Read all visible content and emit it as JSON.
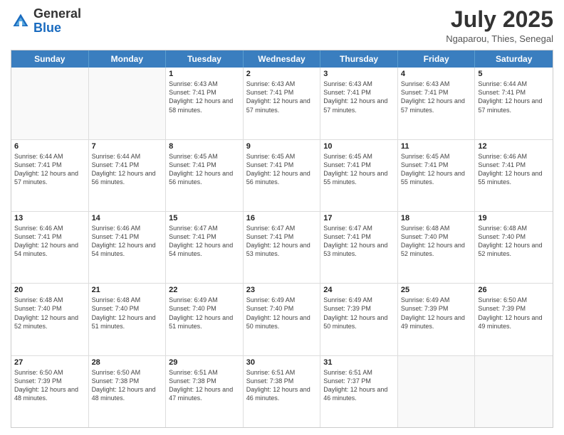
{
  "header": {
    "logo_general": "General",
    "logo_blue": "Blue",
    "month_year": "July 2025",
    "location": "Ngaparou, Thies, Senegal"
  },
  "days_of_week": [
    "Sunday",
    "Monday",
    "Tuesday",
    "Wednesday",
    "Thursday",
    "Friday",
    "Saturday"
  ],
  "weeks": [
    [
      {
        "day": "",
        "sunrise": "",
        "sunset": "",
        "daylight": "",
        "empty": true
      },
      {
        "day": "",
        "sunrise": "",
        "sunset": "",
        "daylight": "",
        "empty": true
      },
      {
        "day": "1",
        "sunrise": "Sunrise: 6:43 AM",
        "sunset": "Sunset: 7:41 PM",
        "daylight": "Daylight: 12 hours and 58 minutes."
      },
      {
        "day": "2",
        "sunrise": "Sunrise: 6:43 AM",
        "sunset": "Sunset: 7:41 PM",
        "daylight": "Daylight: 12 hours and 57 minutes."
      },
      {
        "day": "3",
        "sunrise": "Sunrise: 6:43 AM",
        "sunset": "Sunset: 7:41 PM",
        "daylight": "Daylight: 12 hours and 57 minutes."
      },
      {
        "day": "4",
        "sunrise": "Sunrise: 6:43 AM",
        "sunset": "Sunset: 7:41 PM",
        "daylight": "Daylight: 12 hours and 57 minutes."
      },
      {
        "day": "5",
        "sunrise": "Sunrise: 6:44 AM",
        "sunset": "Sunset: 7:41 PM",
        "daylight": "Daylight: 12 hours and 57 minutes."
      }
    ],
    [
      {
        "day": "6",
        "sunrise": "Sunrise: 6:44 AM",
        "sunset": "Sunset: 7:41 PM",
        "daylight": "Daylight: 12 hours and 57 minutes."
      },
      {
        "day": "7",
        "sunrise": "Sunrise: 6:44 AM",
        "sunset": "Sunset: 7:41 PM",
        "daylight": "Daylight: 12 hours and 56 minutes."
      },
      {
        "day": "8",
        "sunrise": "Sunrise: 6:45 AM",
        "sunset": "Sunset: 7:41 PM",
        "daylight": "Daylight: 12 hours and 56 minutes."
      },
      {
        "day": "9",
        "sunrise": "Sunrise: 6:45 AM",
        "sunset": "Sunset: 7:41 PM",
        "daylight": "Daylight: 12 hours and 56 minutes."
      },
      {
        "day": "10",
        "sunrise": "Sunrise: 6:45 AM",
        "sunset": "Sunset: 7:41 PM",
        "daylight": "Daylight: 12 hours and 55 minutes."
      },
      {
        "day": "11",
        "sunrise": "Sunrise: 6:45 AM",
        "sunset": "Sunset: 7:41 PM",
        "daylight": "Daylight: 12 hours and 55 minutes."
      },
      {
        "day": "12",
        "sunrise": "Sunrise: 6:46 AM",
        "sunset": "Sunset: 7:41 PM",
        "daylight": "Daylight: 12 hours and 55 minutes."
      }
    ],
    [
      {
        "day": "13",
        "sunrise": "Sunrise: 6:46 AM",
        "sunset": "Sunset: 7:41 PM",
        "daylight": "Daylight: 12 hours and 54 minutes."
      },
      {
        "day": "14",
        "sunrise": "Sunrise: 6:46 AM",
        "sunset": "Sunset: 7:41 PM",
        "daylight": "Daylight: 12 hours and 54 minutes."
      },
      {
        "day": "15",
        "sunrise": "Sunrise: 6:47 AM",
        "sunset": "Sunset: 7:41 PM",
        "daylight": "Daylight: 12 hours and 54 minutes."
      },
      {
        "day": "16",
        "sunrise": "Sunrise: 6:47 AM",
        "sunset": "Sunset: 7:41 PM",
        "daylight": "Daylight: 12 hours and 53 minutes."
      },
      {
        "day": "17",
        "sunrise": "Sunrise: 6:47 AM",
        "sunset": "Sunset: 7:41 PM",
        "daylight": "Daylight: 12 hours and 53 minutes."
      },
      {
        "day": "18",
        "sunrise": "Sunrise: 6:48 AM",
        "sunset": "Sunset: 7:40 PM",
        "daylight": "Daylight: 12 hours and 52 minutes."
      },
      {
        "day": "19",
        "sunrise": "Sunrise: 6:48 AM",
        "sunset": "Sunset: 7:40 PM",
        "daylight": "Daylight: 12 hours and 52 minutes."
      }
    ],
    [
      {
        "day": "20",
        "sunrise": "Sunrise: 6:48 AM",
        "sunset": "Sunset: 7:40 PM",
        "daylight": "Daylight: 12 hours and 52 minutes."
      },
      {
        "day": "21",
        "sunrise": "Sunrise: 6:48 AM",
        "sunset": "Sunset: 7:40 PM",
        "daylight": "Daylight: 12 hours and 51 minutes."
      },
      {
        "day": "22",
        "sunrise": "Sunrise: 6:49 AM",
        "sunset": "Sunset: 7:40 PM",
        "daylight": "Daylight: 12 hours and 51 minutes."
      },
      {
        "day": "23",
        "sunrise": "Sunrise: 6:49 AM",
        "sunset": "Sunset: 7:40 PM",
        "daylight": "Daylight: 12 hours and 50 minutes."
      },
      {
        "day": "24",
        "sunrise": "Sunrise: 6:49 AM",
        "sunset": "Sunset: 7:39 PM",
        "daylight": "Daylight: 12 hours and 50 minutes."
      },
      {
        "day": "25",
        "sunrise": "Sunrise: 6:49 AM",
        "sunset": "Sunset: 7:39 PM",
        "daylight": "Daylight: 12 hours and 49 minutes."
      },
      {
        "day": "26",
        "sunrise": "Sunrise: 6:50 AM",
        "sunset": "Sunset: 7:39 PM",
        "daylight": "Daylight: 12 hours and 49 minutes."
      }
    ],
    [
      {
        "day": "27",
        "sunrise": "Sunrise: 6:50 AM",
        "sunset": "Sunset: 7:39 PM",
        "daylight": "Daylight: 12 hours and 48 minutes."
      },
      {
        "day": "28",
        "sunrise": "Sunrise: 6:50 AM",
        "sunset": "Sunset: 7:38 PM",
        "daylight": "Daylight: 12 hours and 48 minutes."
      },
      {
        "day": "29",
        "sunrise": "Sunrise: 6:51 AM",
        "sunset": "Sunset: 7:38 PM",
        "daylight": "Daylight: 12 hours and 47 minutes."
      },
      {
        "day": "30",
        "sunrise": "Sunrise: 6:51 AM",
        "sunset": "Sunset: 7:38 PM",
        "daylight": "Daylight: 12 hours and 46 minutes."
      },
      {
        "day": "31",
        "sunrise": "Sunrise: 6:51 AM",
        "sunset": "Sunset: 7:37 PM",
        "daylight": "Daylight: 12 hours and 46 minutes."
      },
      {
        "day": "",
        "sunrise": "",
        "sunset": "",
        "daylight": "",
        "empty": true
      },
      {
        "day": "",
        "sunrise": "",
        "sunset": "",
        "daylight": "",
        "empty": true
      }
    ]
  ]
}
